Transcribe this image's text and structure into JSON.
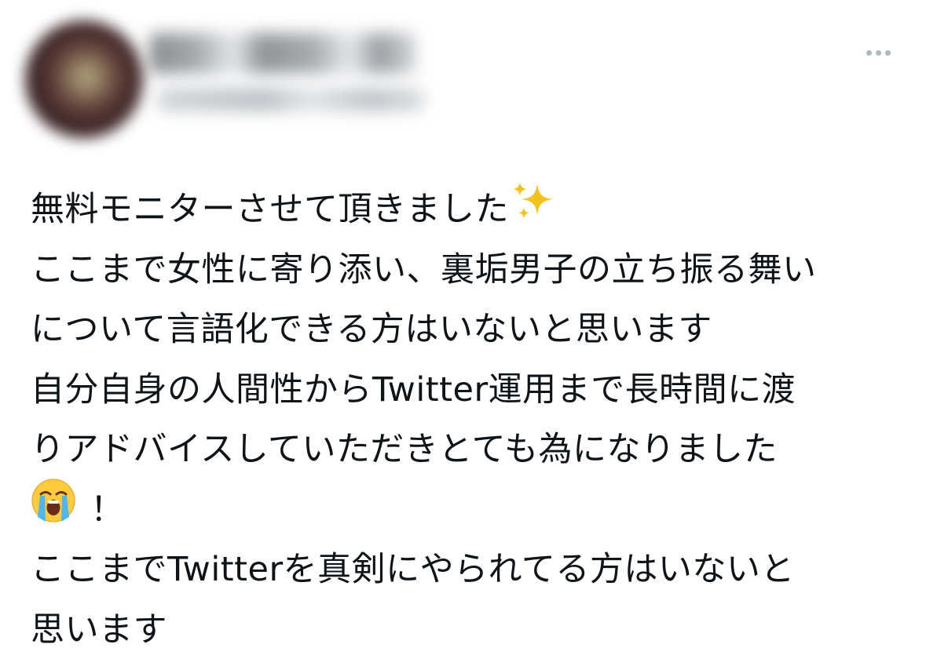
{
  "tweet": {
    "more_icon": "more-dots-icon",
    "lines": [
      "無料モニターさせて頂きました",
      "ここまで女性に寄り添い、裏垢男子の立ち振る舞い",
      "について言語化できる方はいないと思います",
      "自分自身の人間性からTwitter運用まで長時間に渡",
      "りアドバイスしていただきとても為になりました",
      "！",
      "ここまでTwitterを真剣にやられてる方はいないと",
      "思います"
    ],
    "emoji": {
      "sparkles": "sparkles-icon",
      "crying": "loudly-crying-face-icon"
    },
    "colors": {
      "text": "#0f1419",
      "more_dots": "#aab8c2",
      "background": "#ffffff"
    }
  }
}
